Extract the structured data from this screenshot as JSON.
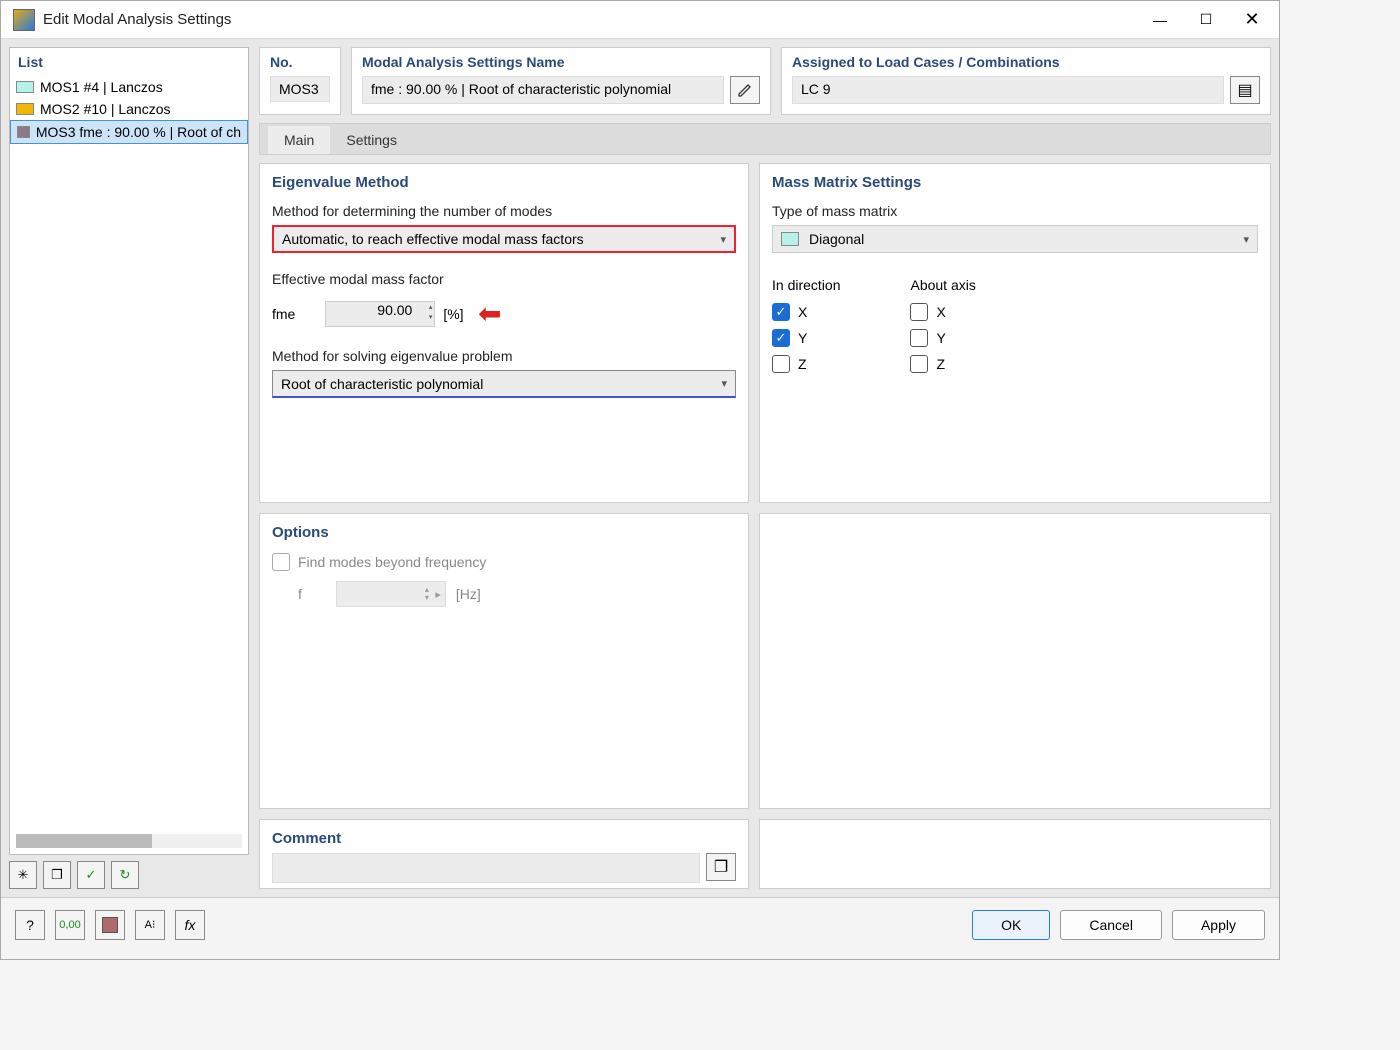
{
  "window": {
    "title": "Edit Modal Analysis Settings"
  },
  "list": {
    "header": "List",
    "items": [
      {
        "color": "#b5f2ea",
        "text": "MOS1  #4 | Lanczos"
      },
      {
        "color": "#f2b705",
        "text": "MOS2  #10 | Lanczos"
      },
      {
        "color": "#8a7a8a",
        "text": "MOS3  fme : 90.00 % | Root of ch"
      }
    ]
  },
  "header_cards": {
    "no_label": "No.",
    "no_value": "MOS3",
    "name_label": "Modal Analysis Settings Name",
    "name_value": "fme : 90.00 % | Root of characteristic polynomial",
    "assigned_label": "Assigned to Load Cases / Combinations",
    "assigned_value": "LC 9"
  },
  "tabs": {
    "main": "Main",
    "settings": "Settings"
  },
  "eigen": {
    "title": "Eigenvalue Method",
    "method_modes_label": "Method for determining the number of modes",
    "method_modes_value": "Automatic, to reach effective modal mass factors",
    "emm_label": "Effective modal mass factor",
    "fme_symbol": "fme",
    "fme_value": "90.00",
    "fme_unit": "[%]",
    "solve_label": "Method for solving eigenvalue problem",
    "solve_value": "Root of characteristic polynomial"
  },
  "mass": {
    "title": "Mass Matrix Settings",
    "type_label": "Type of mass matrix",
    "type_value": "Diagonal",
    "dir_label": "In direction",
    "axis_label": "About axis",
    "x": "X",
    "y": "Y",
    "z": "Z"
  },
  "options": {
    "title": "Options",
    "find_modes": "Find modes beyond frequency",
    "f_symbol": "f",
    "f_unit": "[Hz]"
  },
  "comment": {
    "title": "Comment"
  },
  "buttons": {
    "ok": "OK",
    "cancel": "Cancel",
    "apply": "Apply"
  }
}
